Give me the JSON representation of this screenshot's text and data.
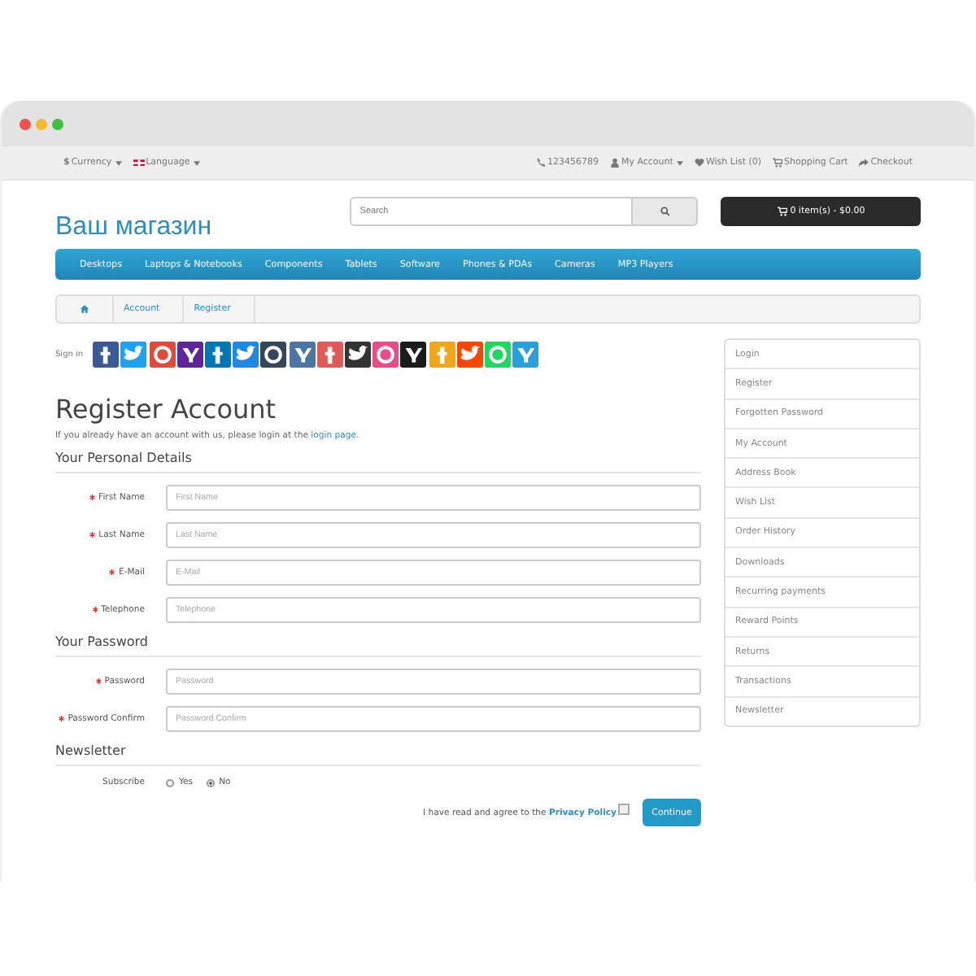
{
  "topbar": {
    "currency_symbol": "$",
    "currency": "Currency",
    "language": "Language",
    "phone": "123456789",
    "account": "My Account",
    "wishlist": "Wish List (0)",
    "cart": "Shopping Cart",
    "checkout": "Checkout"
  },
  "header": {
    "logo": "Ваш магазин",
    "search": {
      "placeholder": "Search"
    },
    "cart_button": "0 item(s) - $0.00"
  },
  "menu": [
    "Desktops",
    "Laptops & Notebooks",
    "Components",
    "Tablets",
    "Software",
    "Phones & PDAs",
    "Cameras",
    "MP3 Players"
  ],
  "breadcrumb": [
    "Account",
    "Register"
  ],
  "sign_in": {
    "label": "Sign in",
    "providers": [
      {
        "color": "#3b5998"
      },
      {
        "color": "#1da1f2"
      },
      {
        "color": "#dd4b39"
      },
      {
        "color": "#5f2699"
      },
      {
        "color": "#0077b5"
      },
      {
        "color": "#1e88e5"
      },
      {
        "color": "#35465c"
      },
      {
        "color": "#4c75a3"
      },
      {
        "color": "#e05a5a"
      },
      {
        "color": "#333333"
      },
      {
        "color": "#ea4c89"
      },
      {
        "color": "#1b1b1b"
      },
      {
        "color": "#f0a51c"
      },
      {
        "color": "#ff4500"
      },
      {
        "color": "#1ed760"
      },
      {
        "color": "#2aa0da"
      }
    ]
  },
  "title": "Register Account",
  "intro": "If you already have an account with us, please login at the ",
  "intro_link": "login page",
  "intro_end": ".",
  "sections": [
    {
      "heading": "Your Personal Details",
      "fields": [
        {
          "label": "First Name",
          "placeholder": "First Name",
          "required": true
        },
        {
          "label": "Last Name",
          "placeholder": "Last Name",
          "required": true
        },
        {
          "label": "E-Mail",
          "placeholder": "E-Mail",
          "required": true
        },
        {
          "label": "Telephone",
          "placeholder": "Telephone",
          "required": true
        }
      ]
    },
    {
      "heading": "Your Password",
      "fields": [
        {
          "label": "Password",
          "placeholder": "Password",
          "required": true
        },
        {
          "label": "Password Confirm",
          "placeholder": "Password Confirm",
          "required": true
        }
      ]
    },
    {
      "heading": "Newsletter",
      "radio": {
        "label": "Subscribe",
        "options": [
          {
            "label": "Yes",
            "selected": false
          },
          {
            "label": "No",
            "selected": true
          }
        ]
      }
    }
  ],
  "agree": {
    "text": "I have read and agree to the ",
    "link": "Privacy Policy",
    "checked": false
  },
  "continue": "Continue",
  "sidebar": {
    "items": [
      "Login",
      "Register",
      "Forgotten Password",
      "My Account",
      "Address Book",
      "Wish List",
      "Order History",
      "Downloads",
      "Recurring payments",
      "Reward Points",
      "Returns",
      "Transactions",
      "Newsletter"
    ]
  }
}
